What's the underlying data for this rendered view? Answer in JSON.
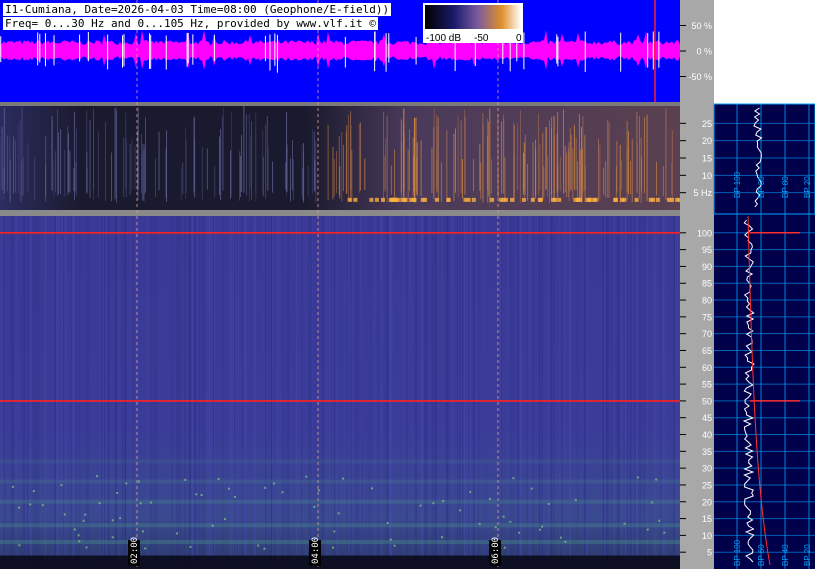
{
  "header": {
    "line1": "I1-Cumiana, Date=2026-04-03 Time=08:00 (Geophone/E-field))",
    "line2": "Freq= 0...30 Hz and 0...105 Hz, provided by www.vlf.it ©"
  },
  "colorbar": {
    "labels": [
      "-100 dB",
      "-50",
      "0"
    ]
  },
  "colors": {
    "waveform_bg": "#0000ff",
    "waveform_trace": "#ff00ff",
    "side_panel_bg": "#00004a",
    "axis_panel_bg": "#a8a8a8",
    "spectrogram_base": "#3a3a9a",
    "marker_red": "#ff2020"
  },
  "chart_data": [
    {
      "type": "line",
      "panel": "waveform",
      "y_tick_labels": [
        "50 %",
        "0 %",
        "-50 %"
      ],
      "y_ticks": [
        50,
        0,
        -50
      ],
      "ylim": [
        -100,
        100
      ]
    },
    {
      "type": "heatmap",
      "panel": "spectrogram-low",
      "y_tick_labels": [
        "25",
        "20",
        "15",
        "10",
        "5 Hz"
      ],
      "y_ticks": [
        25,
        20,
        15,
        10,
        5
      ],
      "ylim": [
        0,
        30
      ],
      "profile_labels": [
        "BP 100",
        "BP 60",
        "BP 80",
        "BP 20"
      ]
    },
    {
      "type": "heatmap",
      "panel": "spectrogram-main",
      "x_tick_labels": [
        "02:00",
        "04:00",
        "06:00"
      ],
      "y_tick_labels": [
        "100",
        "95",
        "90",
        "85",
        "80",
        "75",
        "70",
        "65",
        "60",
        "55",
        "50",
        "45",
        "40",
        "35",
        "30",
        "25",
        "20",
        "15",
        "10",
        "5"
      ],
      "y_ticks": [
        100,
        95,
        90,
        85,
        80,
        75,
        70,
        65,
        60,
        55,
        50,
        45,
        40,
        35,
        30,
        25,
        20,
        15,
        10,
        5
      ],
      "ylim": [
        0,
        105
      ],
      "strong_lines_hz": [
        50,
        100
      ],
      "profile_labels": [
        "BP 100",
        "BP 60",
        "BP 40",
        "BP 20"
      ]
    }
  ]
}
